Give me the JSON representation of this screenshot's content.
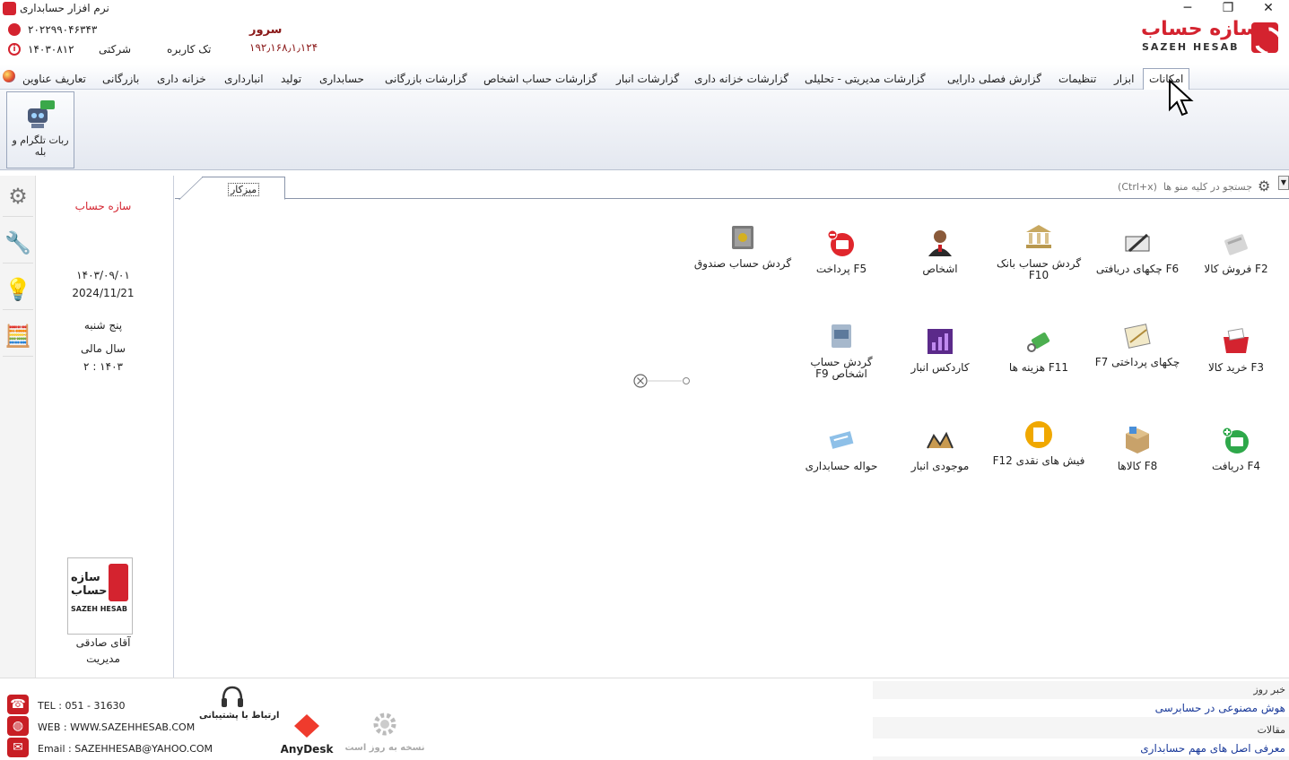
{
  "window": {
    "title": "نرم افزار حسابداری",
    "minimize": "─",
    "restore": "❐",
    "close": "✕"
  },
  "header": {
    "phone": "۲۰۲۲۹۹۰۴۶۳۴۳",
    "date_code": "۱۴۰۳۰۸۱۲",
    "company_label": "شرکتی",
    "user_mode": "تک کاربره",
    "server_label": "سرور",
    "server_ip": "۱۹۲٫۱۶۸٫۱٫۱۲۴",
    "logo_fa": "سازه حساب",
    "logo_en": "SAZEH HESAB"
  },
  "menu": {
    "tabs": [
      "امکانات",
      "ابزار",
      "تنظیمات",
      "گزارش فصلی دارایی",
      "گزارشات مدیریتی - تحلیلی",
      "گزارشات خزانه داری",
      "گزارشات انبار",
      "گزارشات حساب اشخاص",
      "گزارشات بازرگانی",
      "حسابداری",
      "تولید",
      "انبارداری",
      "خزانه داری",
      "بازرگانی",
      "تعاریف عناوین"
    ]
  },
  "ribbon": {
    "button_label": "ربات تلگرام و بله"
  },
  "info": {
    "company": "سازه حساب",
    "date_fa": "۱۴۰۳/۰۹/۰۱",
    "date_en": "2024/11/21",
    "weekday": "پنج شنبه",
    "fiscal_label": "سال مالی",
    "fiscal_value": "۱۴۰۳ : ۲",
    "user_name": "آقای صادقی",
    "user_role": "مدیریت",
    "logo_fa": "سازه حساب",
    "logo_en": "SAZEH HESAB"
  },
  "desk": {
    "tab_label": "میزکار",
    "search_placeholder": "جستجو در کلیه منو ها  (Ctrl+x)",
    "items": [
      {
        "label": "F2  فروش کالا",
        "icon": "sales-icon"
      },
      {
        "label": "F6  چکهای دریافتی",
        "icon": "received-checks-icon"
      },
      {
        "label": "گردش حساب بانک F10",
        "icon": "bank-icon"
      },
      {
        "label": "اشخاص",
        "icon": "person-icon"
      },
      {
        "label": "F5  پرداخت",
        "icon": "payment-icon"
      },
      {
        "label": "گردش حساب صندوق",
        "icon": "safe-icon"
      },
      {
        "label": "F3  خرید کالا",
        "icon": "purchase-icon"
      },
      {
        "label": "چکهای پرداختی F7",
        "icon": "paid-checks-icon"
      },
      {
        "label": "F11  هزینه ها",
        "icon": "expenses-icon"
      },
      {
        "label": "کاردکس انبار",
        "icon": "cardex-icon"
      },
      {
        "label": "گردش حساب اشخاص  F9",
        "icon": "persons-ledger-icon"
      },
      {
        "label": "F4  دریافت",
        "icon": "receipt-icon"
      },
      {
        "label": "F8  کالاها",
        "icon": "goods-icon"
      },
      {
        "label": "فیش های نقدی F12",
        "icon": "cash-slips-icon"
      },
      {
        "label": "موجودی انبار",
        "icon": "inventory-icon"
      },
      {
        "label": "حواله حسابداری",
        "icon": "accounting-voucher-icon"
      }
    ]
  },
  "bottom": {
    "tel": "TEL : 051 - 31630",
    "web": "WEB : WWW.SAZEHHESAB.COM",
    "email": "Email : SAZEHHESAB@YAHOO.COM",
    "support": "ارتباط با پشتیبانی",
    "anydesk": "AnyDesk",
    "updated": "نسخه به روز است",
    "news_title": "خبر روز",
    "news_item": "هوش مصنوعی در حسابرسی",
    "articles_title": "مقالات",
    "articles_item": "معرفی اصل های مهم حسابداری"
  }
}
